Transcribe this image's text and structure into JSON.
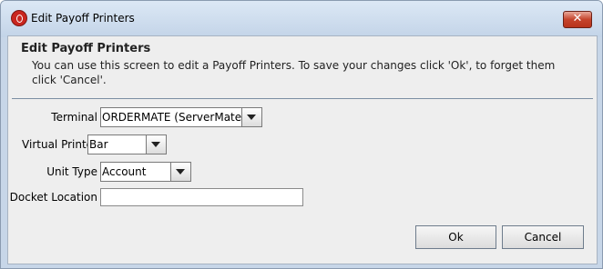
{
  "window": {
    "title": "Edit Payoff Printers",
    "close_symbol": "✕",
    "app_icon": "app-logo-icon"
  },
  "header": {
    "title": "Edit Payoff Printers",
    "description": "You can use this screen to edit a Payoff Printers. To save your changes click 'Ok', to forget them click 'Cancel'."
  },
  "form": {
    "terminal": {
      "label": "Terminal",
      "value": "ORDERMATE (ServerMate)"
    },
    "virtual_printer": {
      "label": "Virtual Printer",
      "value": "Bar"
    },
    "unit_type": {
      "label": "Unit Type",
      "value": "Account"
    },
    "docket_location": {
      "label": "Docket Location",
      "value": ""
    }
  },
  "buttons": {
    "ok": "Ok",
    "cancel": "Cancel"
  }
}
